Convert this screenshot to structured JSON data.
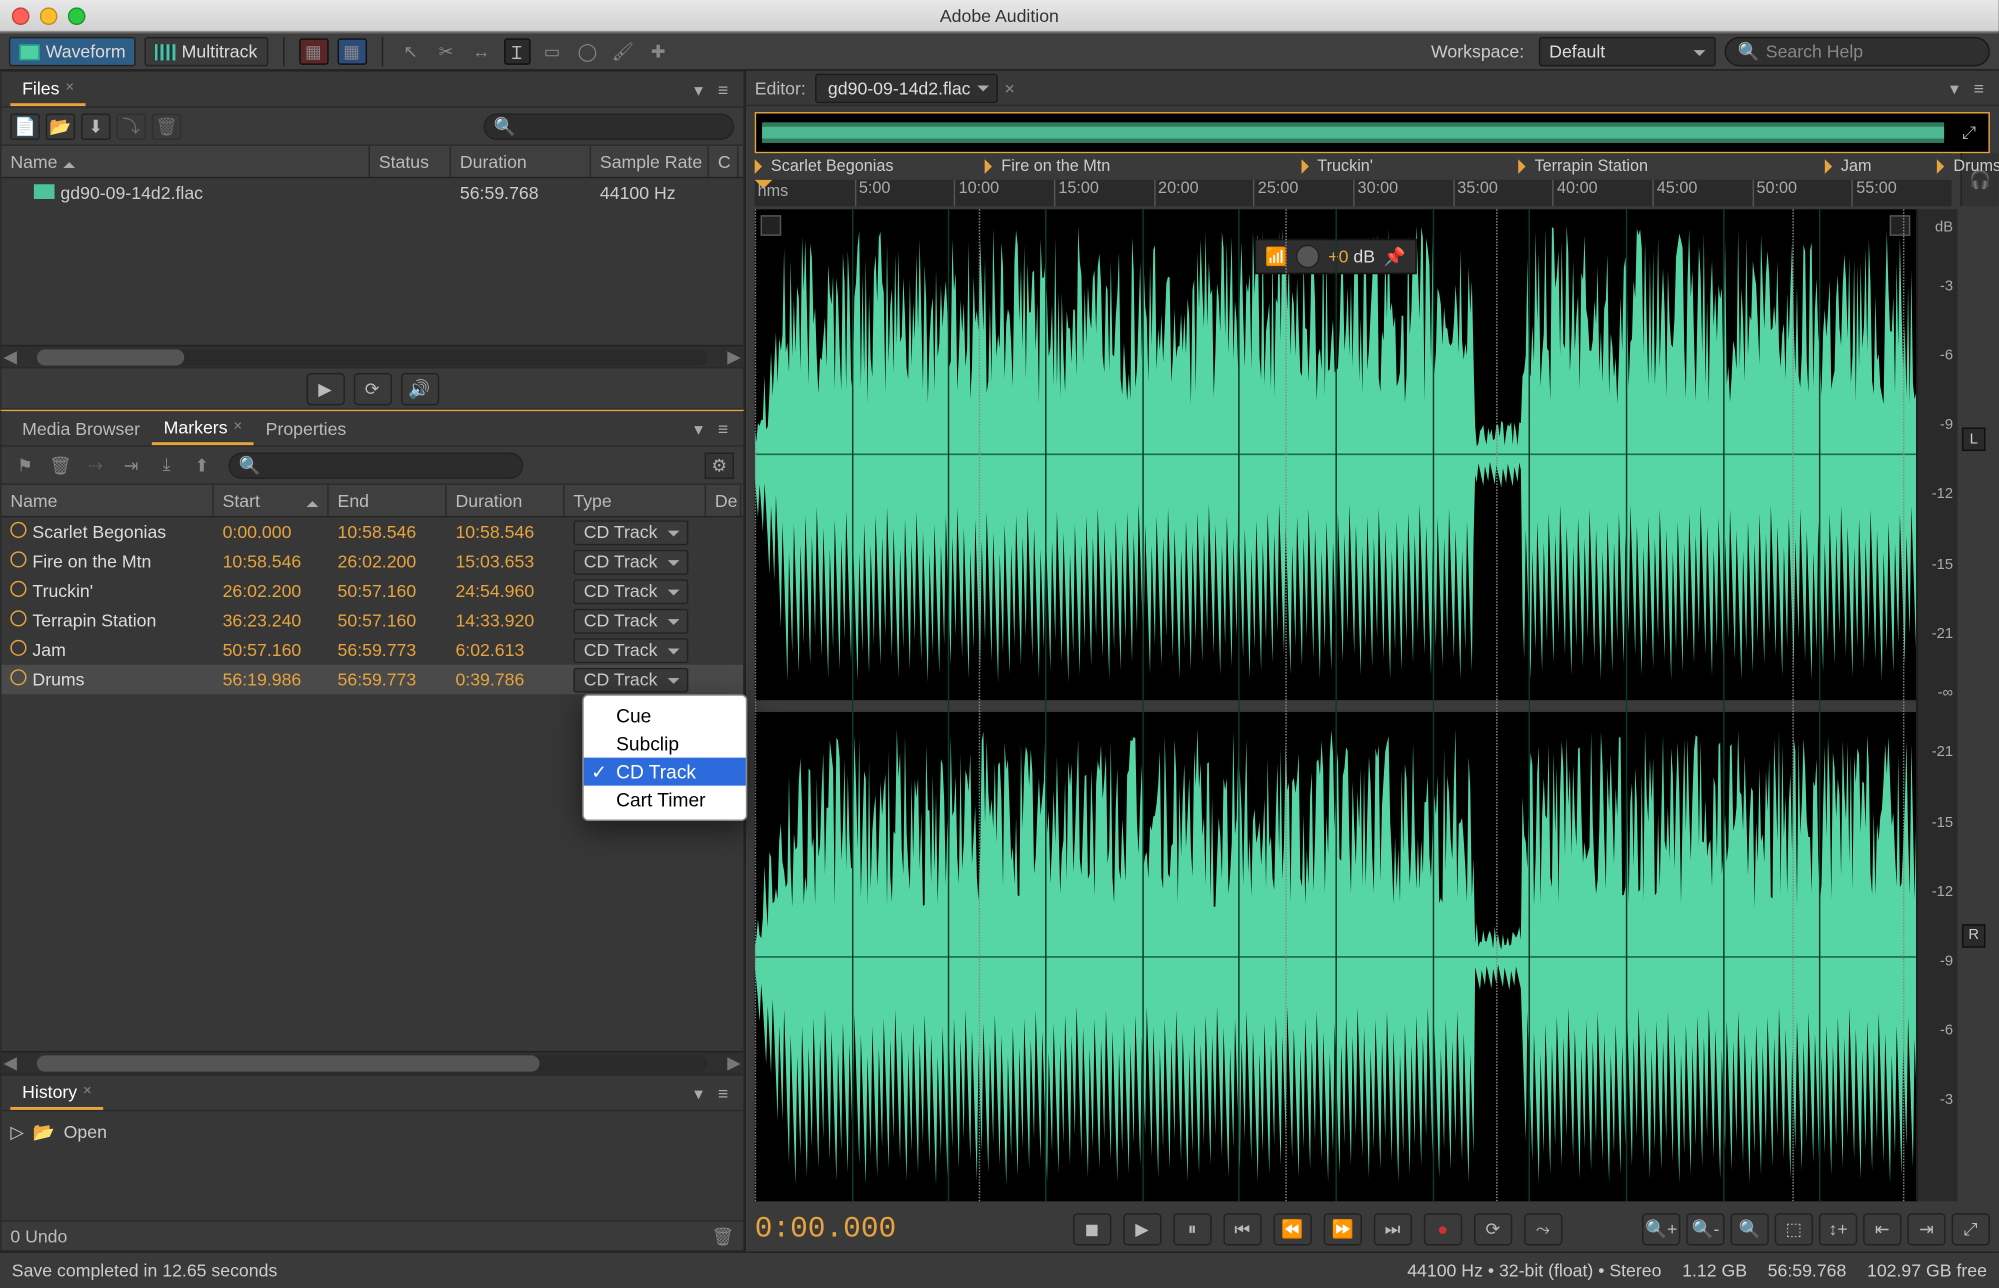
{
  "app_title": "Adobe Audition",
  "toolbar": {
    "waveform": "Waveform",
    "multitrack": "Multitrack",
    "workspace_label": "Workspace:",
    "workspace_value": "Default",
    "search_placeholder": "Search Help"
  },
  "files_panel": {
    "tab": "Files",
    "cols": {
      "name": "Name",
      "status": "Status",
      "duration": "Duration",
      "sample_rate": "Sample Rate",
      "channels": "C"
    },
    "rows": [
      {
        "name": "gd90-09-14d2.flac",
        "status": "",
        "duration": "56:59.768",
        "sample_rate": "44100 Hz"
      }
    ]
  },
  "tabs_panel": {
    "media_browser": "Media Browser",
    "markers": "Markers",
    "properties": "Properties"
  },
  "markers_panel": {
    "cols": {
      "name": "Name",
      "start": "Start",
      "end": "End",
      "duration": "Duration",
      "type": "Type",
      "desc": "De"
    },
    "rows": [
      {
        "name": "Scarlet Begonias",
        "start": "0:00.000",
        "end": "10:58.546",
        "duration": "10:58.546",
        "type": "CD Track"
      },
      {
        "name": "Fire on the Mtn",
        "start": "10:58.546",
        "end": "26:02.200",
        "duration": "15:03.653",
        "type": "CD Track"
      },
      {
        "name": "Truckin'",
        "start": "26:02.200",
        "end": "50:57.160",
        "duration": "24:54.960",
        "type": "CD Track"
      },
      {
        "name": "Terrapin Station",
        "start": "36:23.240",
        "end": "50:57.160",
        "duration": "14:33.920",
        "type": "CD Track"
      },
      {
        "name": "Jam",
        "start": "50:57.160",
        "end": "56:59.773",
        "duration": "6:02.613",
        "type": "CD Track"
      },
      {
        "name": "Drums",
        "start": "56:19.986",
        "end": "56:59.773",
        "duration": "0:39.786",
        "type": "CD Track"
      }
    ],
    "type_menu": [
      "Cue",
      "Subclip",
      "CD Track",
      "Cart Timer"
    ],
    "type_selected": "CD Track"
  },
  "history_panel": {
    "tab": "History",
    "rows": [
      {
        "label": "Open"
      }
    ],
    "footer": "0 Undo"
  },
  "editor": {
    "title": "Editor:",
    "file": "gd90-09-14d2.flac",
    "markers": [
      {
        "name": "Scarlet Begonias",
        "pos": 0.0
      },
      {
        "name": "Fire on the Mtn",
        "pos": 19.25
      },
      {
        "name": "Truckin'",
        "pos": 45.65
      },
      {
        "name": "Terrapin Station",
        "pos": 63.8
      },
      {
        "name": "Jam",
        "pos": 89.4
      },
      {
        "name": "Drums",
        "pos": 98.8
      }
    ],
    "ruler_label": "hms",
    "ticks": [
      "5:00",
      "10:00",
      "15:00",
      "20:00",
      "25:00",
      "30:00",
      "35:00",
      "40:00",
      "45:00",
      "50:00",
      "55:00"
    ],
    "hud_db": "+0",
    "hud_db_unit": "dB",
    "db_scale": [
      "dB",
      "-3",
      "-6",
      "-9",
      "-12",
      "-15",
      "-21",
      "-∞",
      "-21",
      "-15",
      "-12",
      "-9",
      "-6",
      "-3"
    ],
    "channels": {
      "L": "L",
      "R": "R"
    },
    "playhead": "0:00.000"
  },
  "status": {
    "message": "Save completed in 12.65 seconds",
    "format": "44100 Hz • 32-bit (float) • Stereo",
    "size": "1.12 GB",
    "duration": "56:59.768",
    "free": "102.97 GB free"
  }
}
